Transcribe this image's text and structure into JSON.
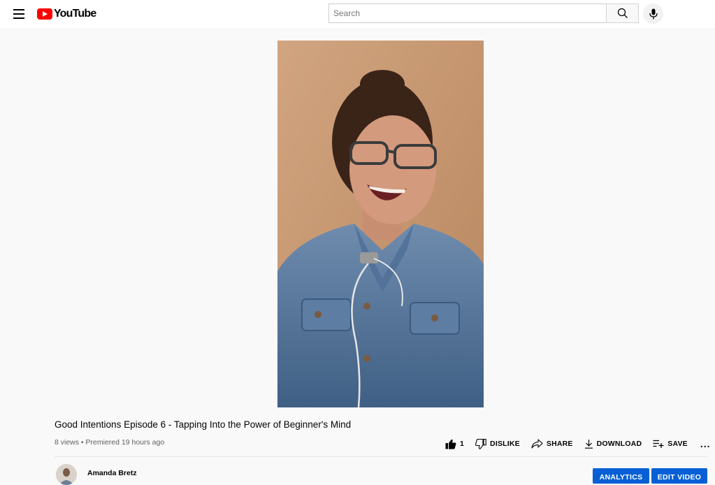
{
  "masthead": {
    "logo_text": "YouTube",
    "search_placeholder": "Search",
    "menu_icon": "hamburger-menu-icon",
    "search_icon": "search-icon",
    "mic_icon": "microphone-icon"
  },
  "video": {
    "title": "Good Intentions Episode 6 - Tapping Into the Power of Beginner's Mind",
    "meta": "8 views • Premiered 19 hours ago"
  },
  "actions": {
    "like_count": "1",
    "dislike_label": "DISLIKE",
    "share_label": "SHARE",
    "download_label": "DOWNLOAD",
    "save_label": "SAVE",
    "more_label": "..."
  },
  "owner": {
    "name": "Amanda Bretz",
    "analytics_label": "ANALYTICS",
    "edit_label": "EDIT VIDEO"
  },
  "colors": {
    "brand_red": "#ff0000",
    "accent_blue": "#065fd4",
    "page_bg": "#f9f9f9"
  }
}
